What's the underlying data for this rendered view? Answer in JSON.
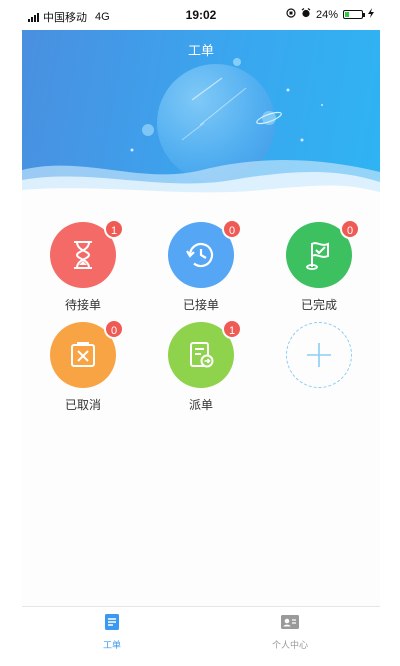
{
  "status_bar": {
    "carrier": "中国移动",
    "network": "4G",
    "time": "19:02",
    "battery": "24%",
    "battery_level": 0.24
  },
  "header": {
    "title": "工单"
  },
  "orders": [
    {
      "label": "待接单",
      "count": "1",
      "color": "#f46a66",
      "icon": "hourglass-icon"
    },
    {
      "label": "已接单",
      "count": "0",
      "color": "#55a6f5",
      "icon": "clock-refresh-icon"
    },
    {
      "label": "已完成",
      "count": "0",
      "color": "#3cc060",
      "icon": "flag-check-icon"
    },
    {
      "label": "已取消",
      "count": "0",
      "color": "#f8a444",
      "icon": "cancel-box-icon"
    },
    {
      "label": "派单",
      "count": "1",
      "color": "#8fd24b",
      "icon": "dispatch-doc-icon"
    }
  ],
  "add_button": {
    "icon": "plus-icon"
  },
  "tabbar": {
    "tabs": [
      {
        "label": "工单",
        "active": true,
        "icon": "document-icon",
        "color": "#3b99f0"
      },
      {
        "label": "个人中心",
        "active": false,
        "icon": "profile-card-icon",
        "color": "#999999"
      }
    ]
  }
}
